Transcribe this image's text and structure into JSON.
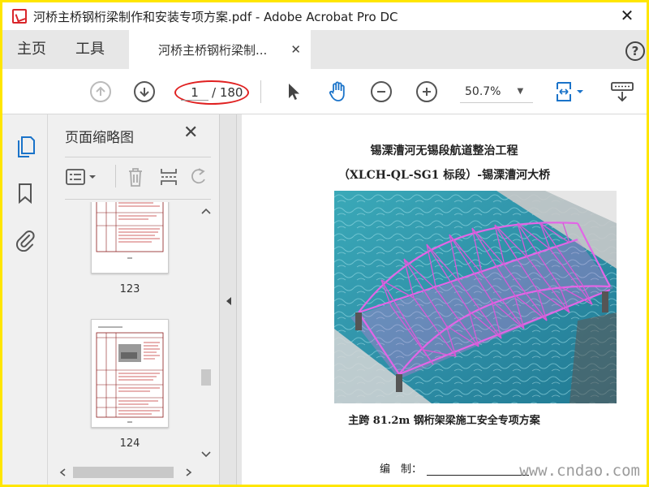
{
  "window": {
    "title": "河桥主桥钢桁梁制作和安装专项方案.pdf - Adobe Acrobat Pro DC",
    "close_glyph": "✕"
  },
  "tabs": {
    "home": "主页",
    "tools": "工具",
    "document": "河桥主桥钢桁梁制...",
    "document_close": "✕",
    "help": "?"
  },
  "toolbar": {
    "page_input": "1",
    "page_total": "/ 180",
    "zoom": "50.7%",
    "icons": [
      "prev-page-icon",
      "next-page-icon",
      "select-arrow-icon",
      "hand-tool-icon",
      "zoom-out-icon",
      "zoom-in-icon",
      "fit-page-icon",
      "keyboard-scroll-icon"
    ]
  },
  "sidebar": {
    "icons": [
      "pages-icon",
      "bookmark-icon",
      "attachment-icon"
    ]
  },
  "thumbnails": {
    "title": "页面缩略图",
    "close": "✕",
    "pages": [
      {
        "number": "123"
      },
      {
        "number": "124"
      }
    ]
  },
  "document": {
    "line1": "锡溧漕河无锡段航道整治工程",
    "line2": "（XLCH-QL-SG1 标段）-锡溧漕河大桥",
    "line3": "主跨 81.2m 钢桁架梁施工安全专项方案",
    "signature_label": "编　制："
  },
  "watermark": "www.cndao.com",
  "colors": {
    "border": "#ffe600",
    "accent": "#1a73c9",
    "annotation": "#e02020",
    "bridge": "#e060e0"
  }
}
